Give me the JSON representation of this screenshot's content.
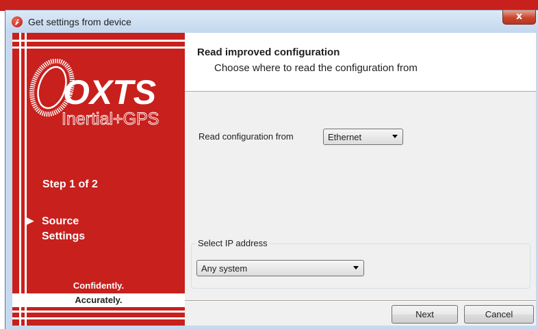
{
  "window": {
    "title": "Get settings from device",
    "close_glyph": "x"
  },
  "sidebar": {
    "logo_brand": "OXTS",
    "logo_sub": "Inertial+GPS",
    "step": "Step 1 of 2",
    "current_marker": "▶",
    "current_step_line1": "Source",
    "current_step_line2": "Settings",
    "tagline1": "Confidently.",
    "tagline2": "Accurately.",
    "colors": {
      "brand_red": "#c8201d",
      "stripe": "#ffffff"
    }
  },
  "header": {
    "title": "Read improved configuration",
    "subtitle": "Choose where to read the configuration from"
  },
  "form": {
    "read_from_label": "Read configuration from",
    "read_from_value": "Ethernet",
    "ip_group_label": "Select IP address",
    "ip_value": "Any system"
  },
  "buttons": {
    "next": "Next",
    "cancel": "Cancel"
  },
  "icons": {
    "app": "oxts-app-icon",
    "close": "close-icon",
    "dropdown": "chevron-down-icon",
    "current_step": "play-arrow-icon"
  }
}
